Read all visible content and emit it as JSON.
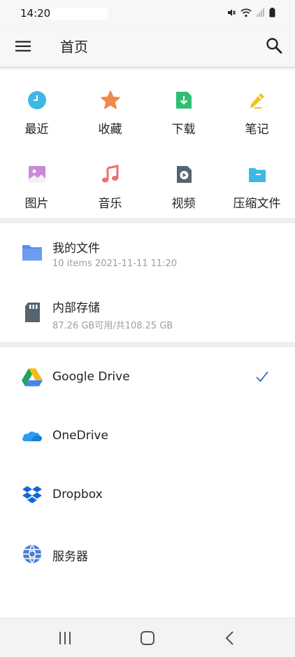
{
  "status_bar": {
    "time": "14:20",
    "icons": [
      "mute-icon",
      "wifi-icon",
      "signal-icon",
      "battery-icon"
    ]
  },
  "app_bar": {
    "title": "首页",
    "menu_icon": "menu-icon",
    "search_icon": "search-icon"
  },
  "shortcuts": [
    {
      "label": "最近",
      "icon": "clock-icon",
      "color": "#3fb7e6"
    },
    {
      "label": "收藏",
      "icon": "star-icon",
      "color": "#f0894a"
    },
    {
      "label": "下载",
      "icon": "download-icon",
      "color": "#2fbf71"
    },
    {
      "label": "笔记",
      "icon": "pencil-icon",
      "color": "#f4c21b"
    },
    {
      "label": "图片",
      "icon": "image-icon",
      "color": "#c98ad8"
    },
    {
      "label": "音乐",
      "icon": "music-icon",
      "color": "#ec6f6c"
    },
    {
      "label": "视频",
      "icon": "video-icon",
      "color": "#546470"
    },
    {
      "label": "压缩文件",
      "icon": "archive-icon",
      "color": "#3fb7e6"
    }
  ],
  "storage": [
    {
      "title": "我的文件",
      "subtitle": "10 items 2021-11-11 11:20",
      "icon": "folder-icon",
      "color": "#5a8de8"
    },
    {
      "title": "内部存储",
      "subtitle": "87.26 GB可用/共108.25 GB",
      "icon": "sd-card-icon",
      "color": "#546470"
    }
  ],
  "cloud": [
    {
      "title": "Google Drive",
      "icon": "google-drive-icon",
      "selected": true
    },
    {
      "title": "OneDrive",
      "icon": "onedrive-icon",
      "selected": false
    },
    {
      "title": "Dropbox",
      "icon": "dropbox-icon",
      "selected": false
    },
    {
      "title": "服务器",
      "icon": "server-globe-icon",
      "selected": false
    }
  ],
  "colors": {
    "accent": "#3a6fc4",
    "divider": "#eeeeee"
  },
  "nav_bar": {
    "icons": [
      "recents-icon",
      "home-icon",
      "back-icon"
    ]
  }
}
